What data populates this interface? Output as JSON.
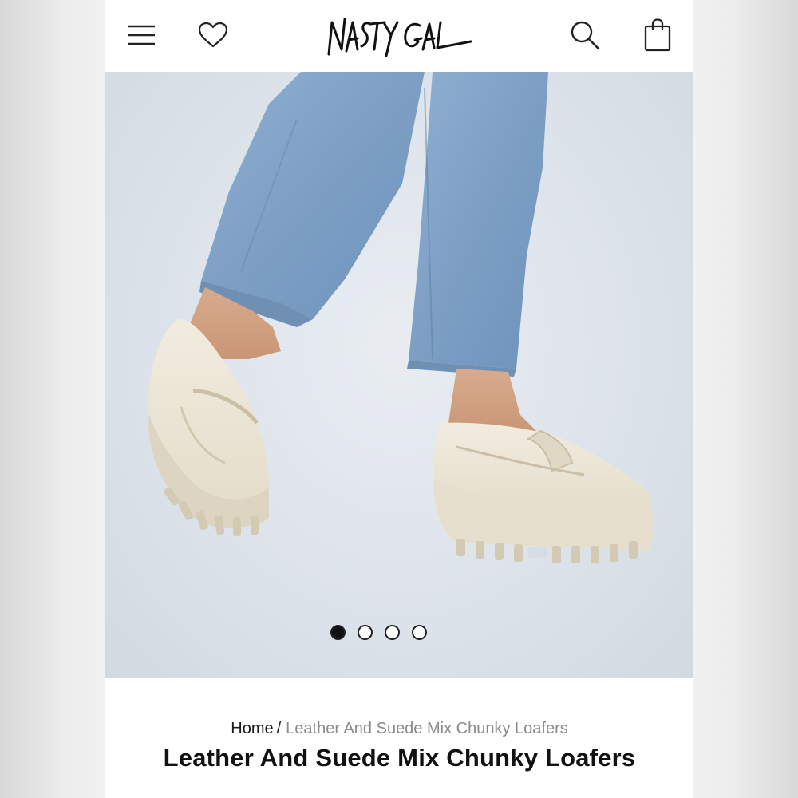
{
  "header": {
    "brand": "NASTY GAL",
    "icons": [
      "menu-icon",
      "heart-icon",
      "search-icon",
      "bag-icon"
    ]
  },
  "gallery": {
    "total_images": 4,
    "active_index": 0,
    "colors": {
      "denim": "#7d9fc4",
      "shoe": "#ece6d6",
      "background": "#dde3ea"
    }
  },
  "breadcrumb": {
    "home": "Home",
    "separator": "/",
    "current": "Leather And Suede Mix Chunky Loafers"
  },
  "product": {
    "title": "Leather And Suede Mix Chunky Loafers"
  }
}
